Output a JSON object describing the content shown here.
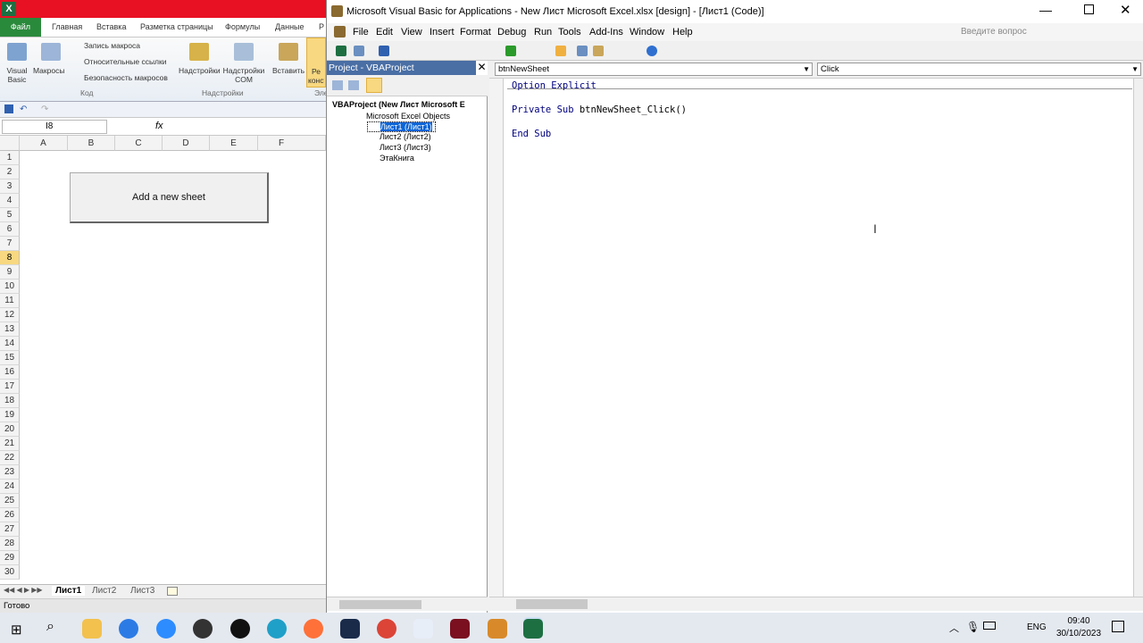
{
  "excel": {
    "logo": "X",
    "file_tab": "Файл",
    "tabs": [
      "Главная",
      "Вставка",
      "Разметка страницы",
      "Формулы",
      "Данные",
      "Р"
    ],
    "ribbon": {
      "visual_basic": "Visual Basic",
      "macros": "Макросы",
      "record_macro": "Запись макроса",
      "relative_refs": "Относительные ссылки",
      "macro_security": "Безопасность макросов",
      "group_code": "Код",
      "addins": "Надстройки",
      "com_addins": "Надстройки COM",
      "group_addins": "Надстройки",
      "insert": "Вставить",
      "design_mode": "Ре конст",
      "group_controls": "Эле"
    },
    "name_box": "I8",
    "fx": "fx",
    "columns": [
      "A",
      "B",
      "C",
      "D",
      "E",
      "F"
    ],
    "rows": [
      "1",
      "2",
      "3",
      "4",
      "5",
      "6",
      "7",
      "8",
      "9",
      "10",
      "11",
      "12",
      "13",
      "14",
      "15",
      "16",
      "17",
      "18",
      "19",
      "20",
      "21",
      "22",
      "23",
      "24",
      "25",
      "26",
      "27",
      "28",
      "29",
      "30"
    ],
    "selected_row": "8",
    "button_label": "Add a new sheet",
    "sheets": [
      "Лист1",
      "Лист2",
      "Лист3"
    ],
    "status": "Готово"
  },
  "vbe": {
    "title": "Microsoft Visual Basic for Applications - New Лист Microsoft Excel.xlsx [design] - [Лист1 (Code)]",
    "menu": [
      "File",
      "Edit",
      "View",
      "Insert",
      "Format",
      "Debug",
      "Run",
      "Tools",
      "Add-Ins",
      "Window",
      "Help"
    ],
    "help_placeholder": "Введите вопрос",
    "project_title": "Project - VBAProject",
    "tree": {
      "root": "VBAProject (New Лист Microsoft E",
      "folder": "Microsoft Excel Objects",
      "items": [
        "Лист1 (Лист1)",
        "Лист2 (Лист2)",
        "Лист3 (Лист3)",
        "ЭтаКнига"
      ]
    },
    "object_combo": "btnNewSheet",
    "proc_combo": "Click",
    "code": {
      "l1_kw": "Option Explicit",
      "l2_kw1": "Private Sub ",
      "l2_rest": "btnNewSheet_Click()",
      "l3_kw": "End Sub"
    }
  },
  "taskbar": {
    "lang": "ENG",
    "time": "09:40",
    "date": "30/10/2023"
  },
  "colors": {
    "excel_red": "#e81123",
    "excel_green": "#1d6f42",
    "selected": "#0a64d6",
    "code_keyword": "#00007f"
  }
}
